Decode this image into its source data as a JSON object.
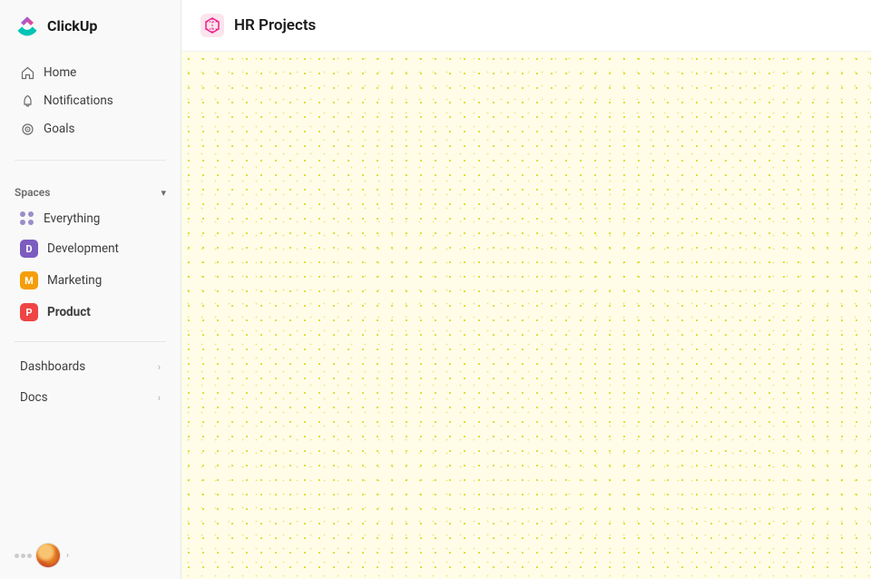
{
  "app": {
    "name": "ClickUp"
  },
  "sidebar": {
    "logo_text": "ClickUp",
    "nav_items": [
      {
        "id": "home",
        "label": "Home",
        "icon": "home-icon"
      },
      {
        "id": "notifications",
        "label": "Notifications",
        "icon": "bell-icon"
      },
      {
        "id": "goals",
        "label": "Goals",
        "icon": "goals-icon"
      }
    ],
    "spaces_label": "Spaces",
    "spaces_items": [
      {
        "id": "everything",
        "label": "Everything",
        "type": "everything"
      },
      {
        "id": "development",
        "label": "Development",
        "type": "badge",
        "badge_color": "#7c5cbf",
        "badge_letter": "D"
      },
      {
        "id": "marketing",
        "label": "Marketing",
        "type": "badge",
        "badge_color": "#f59e0b",
        "badge_letter": "M"
      },
      {
        "id": "product",
        "label": "Product",
        "type": "badge",
        "badge_color": "#ef4444",
        "badge_letter": "P",
        "active": true
      }
    ],
    "expandable_items": [
      {
        "id": "dashboards",
        "label": "Dashboards"
      },
      {
        "id": "docs",
        "label": "Docs"
      }
    ]
  },
  "main": {
    "page_title": "HR Projects"
  }
}
